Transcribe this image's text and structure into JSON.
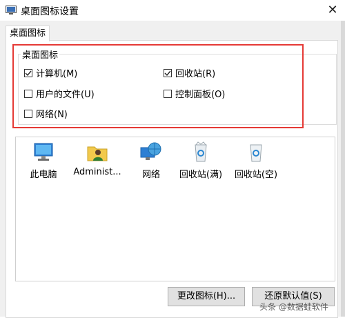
{
  "window": {
    "title": "桌面图标设置"
  },
  "tabs": [
    {
      "label": "桌面图标"
    }
  ],
  "group": {
    "title": "桌面图标",
    "checkboxes": [
      {
        "label": "计算机(M)",
        "checked": true
      },
      {
        "label": "回收站(R)",
        "checked": true
      },
      {
        "label": "用户的文件(U)",
        "checked": false
      },
      {
        "label": "控制面板(O)",
        "checked": false
      },
      {
        "label": "网络(N)",
        "checked": false
      }
    ]
  },
  "icons": [
    {
      "label": "此电脑",
      "icon": "computer-icon"
    },
    {
      "label": "Administ...",
      "icon": "user-folder-icon"
    },
    {
      "label": "网络",
      "icon": "network-icon"
    },
    {
      "label": "回收站(满)",
      "icon": "recycle-bin-full-icon"
    },
    {
      "label": "回收站(空)",
      "icon": "recycle-bin-empty-icon"
    }
  ],
  "buttons": {
    "change_icon": "更改图标(H)...",
    "restore_default": "还原默认值(S)"
  },
  "watermark": "头条 @数据蛙软件"
}
